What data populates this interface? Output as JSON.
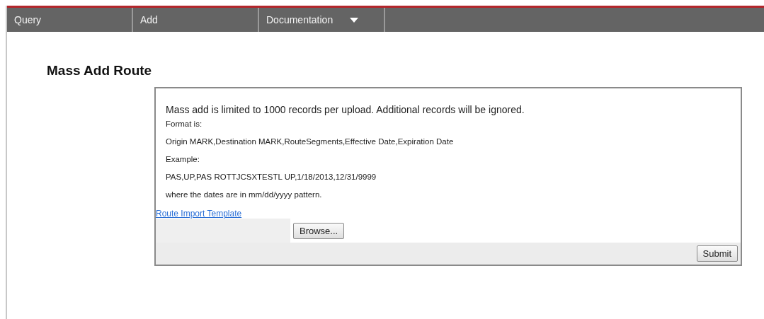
{
  "nav": [
    {
      "label": "Query",
      "dropdown": false
    },
    {
      "label": "Add",
      "dropdown": false
    },
    {
      "label": "Documentation",
      "dropdown": true
    }
  ],
  "title": "Mass Add Route",
  "notice": "Mass add is limited to 1000 records per upload. Additional records will be ignored.",
  "lines": [
    "Format is:",
    "Origin MARK,Destination MARK,RouteSegments,Effective Date,Expiration Date",
    "Example:",
    "PAS,UP,PAS ROTTJCSXTESTL UP,1/18/2013,12/31/9999",
    "where the dates are in mm/dd/yyyy pattern."
  ],
  "template_link": "Route Import Template",
  "browse_button": "Browse...",
  "submit_button": "Submit"
}
